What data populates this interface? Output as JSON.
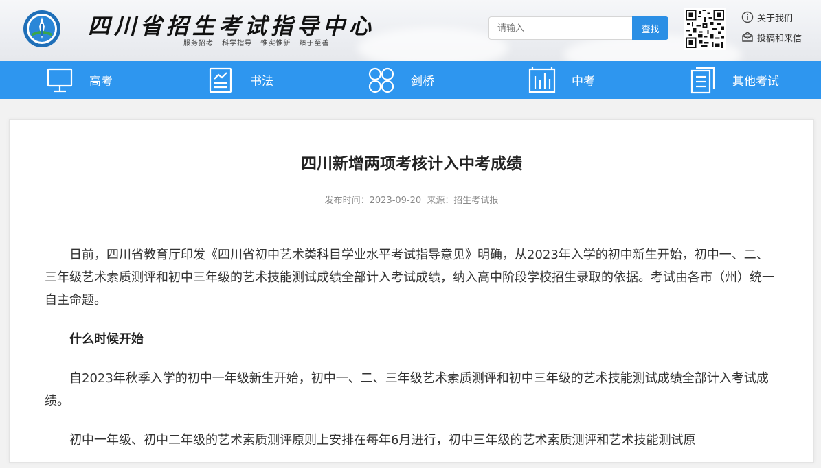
{
  "header": {
    "title": "四川省招生考试指导中心",
    "slogan": "服务招考 科学指导 惟实惟新 臻于至善"
  },
  "search": {
    "placeholder": "请输入",
    "button_label": "查找"
  },
  "top_links": [
    {
      "label": "关于我们",
      "icon": "info-icon"
    },
    {
      "label": "投稿和来信",
      "icon": "mail-icon"
    }
  ],
  "nav": [
    {
      "label": "高考",
      "icon": "monitor-icon"
    },
    {
      "label": "书法",
      "icon": "clipboard-chart-icon"
    },
    {
      "label": "剑桥",
      "icon": "grid-circles-icon"
    },
    {
      "label": "中考",
      "icon": "bar-chart-icon"
    },
    {
      "label": "其他考试",
      "icon": "document-icon"
    }
  ],
  "article": {
    "title": "四川新增两项考核计入中考成绩",
    "meta_date": "发布时间：2023-09-20",
    "meta_source": "来源：招生考试报",
    "paragraphs": [
      "日前，四川省教育厅印发《四川省初中艺术类科目学业水平考试指导意见》明确，从2023年入学的初中新生开始，初中一、二、三年级艺术素质测评和初中三年级的艺术技能测试成绩全部计入考试成绩，纳入高中阶段学校招生录取的依据。考试由各市（州）统一自主命题。",
      "什么时候开始",
      "自2023年秋季入学的初中一年级新生开始，初中一、二、三年级艺术素质测评和初中三年级的艺术技能测试成绩全部计入考试成绩。",
      "初中一年级、初中二年级的艺术素质测评原则上安排在每年6月进行，初中三年级的艺术素质测评和艺术技能测试原"
    ]
  },
  "colors": {
    "nav_bg": "#2e96ef",
    "search_button": "#2b8fe5"
  }
}
